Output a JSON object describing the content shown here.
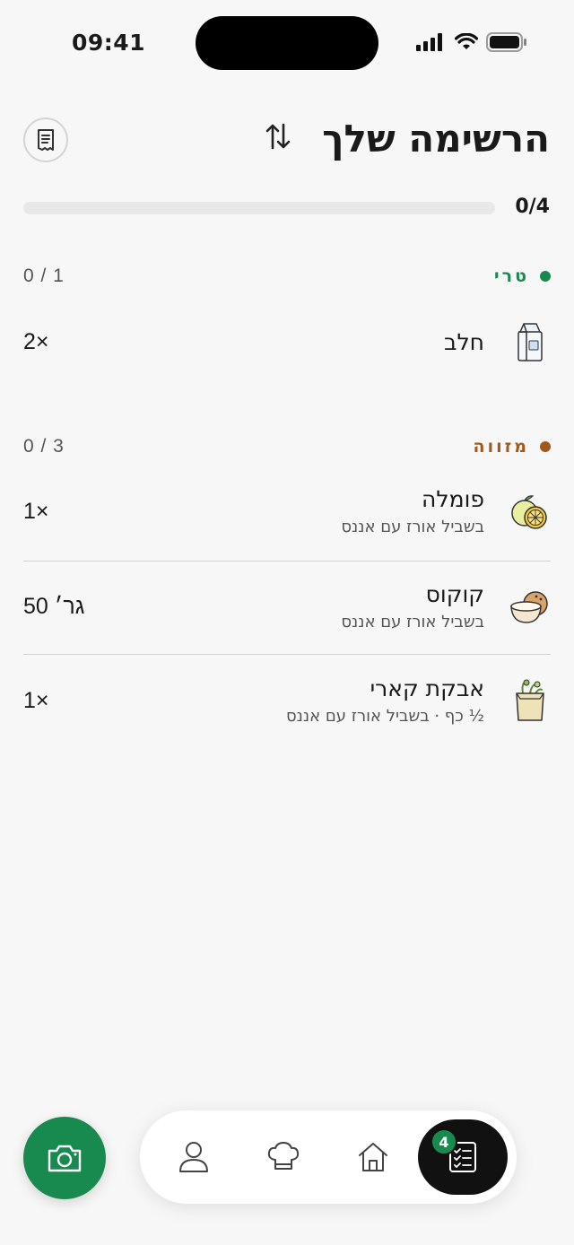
{
  "status_bar": {
    "time": "09:41"
  },
  "header": {
    "title": "הרשימה שלך"
  },
  "progress": {
    "label": "0/4",
    "done": 0,
    "total": 4
  },
  "sections": [
    {
      "name": "טרי",
      "count": "0 / 1",
      "color": "#188a4f",
      "items": [
        {
          "name": "חלב",
          "subtitle": "",
          "qty": "2×",
          "icon": "milk-carton-icon"
        }
      ]
    },
    {
      "name": "מזווה",
      "count": "0 / 3",
      "color": "#a0591a",
      "items": [
        {
          "name": "פומלה",
          "subtitle": "בשביל אורז עם אננס",
          "qty": "1×",
          "icon": "pomelo-icon"
        },
        {
          "name": "קוקוס",
          "subtitle": "בשביל אורז עם אננס",
          "qty": "50 גר׳",
          "icon": "coconut-icon"
        },
        {
          "name": "אבקת קארי",
          "subtitle": "½ כף · בשביל אורז עם אננס",
          "qty": "1×",
          "icon": "grocery-bag-icon"
        }
      ]
    }
  ],
  "nav": {
    "badge_count": "4",
    "items": [
      "profile-icon",
      "chef-hat-icon",
      "home-icon",
      "checklist-icon"
    ],
    "active": "checklist-icon"
  },
  "colors": {
    "accent": "#188a4f",
    "pantry": "#a0591a",
    "nav_active": "#111111"
  }
}
